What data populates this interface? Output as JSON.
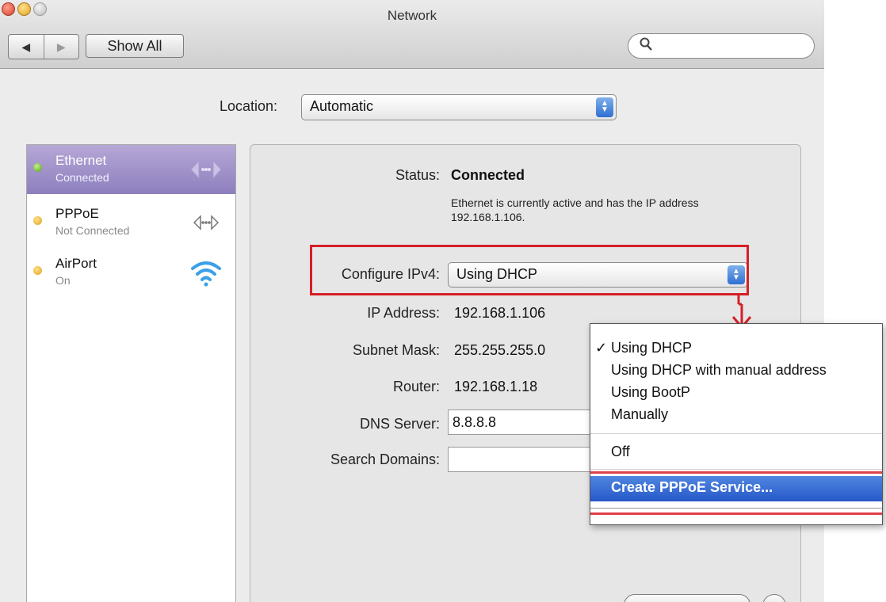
{
  "window": {
    "title": "Network",
    "back_icon": "◀",
    "forward_icon": "▶",
    "show_all_label": "Show All",
    "search_placeholder": ""
  },
  "location": {
    "label": "Location:",
    "value": "Automatic"
  },
  "services": [
    {
      "name": "Ethernet",
      "status": "Connected",
      "indicator": "green",
      "icon": "ethernet-arrows-icon",
      "selected": true
    },
    {
      "name": "PPPoE",
      "status": "Not Connected",
      "indicator": "yellow",
      "icon": "ethernet-arrows-icon",
      "selected": false
    },
    {
      "name": "AirPort",
      "status": "On",
      "indicator": "yellow",
      "icon": "wifi-icon",
      "selected": false
    }
  ],
  "details": {
    "status_label": "Status:",
    "status_value": "Connected",
    "status_note": "Ethernet is currently active and has the IP address 192.168.1.106.",
    "configure_label": "Configure IPv4:",
    "configure_value": "Using DHCP",
    "ip_label": "IP Address:",
    "ip_value": "192.168.1.106",
    "subnet_label": "Subnet Mask:",
    "subnet_value": "255.255.255.0",
    "router_label": "Router:",
    "router_value": "192.168.1.18",
    "dns_label": "DNS Server:",
    "dns_value": "8.8.8.8",
    "search_domains_label": "Search Domains:",
    "search_domains_value": ""
  },
  "menu": {
    "checkmark": "✓",
    "items": [
      "Using DHCP",
      "Using DHCP with manual address",
      "Using BootP",
      "Manually"
    ],
    "checked_index": 0,
    "off_label": "Off",
    "highlighted_label": "Create PPPoE Service..."
  },
  "colors": {
    "annotation_red": "#d61f26",
    "selection_blue": "#2758c9",
    "sidebar_selected": "#8d7fbd"
  }
}
